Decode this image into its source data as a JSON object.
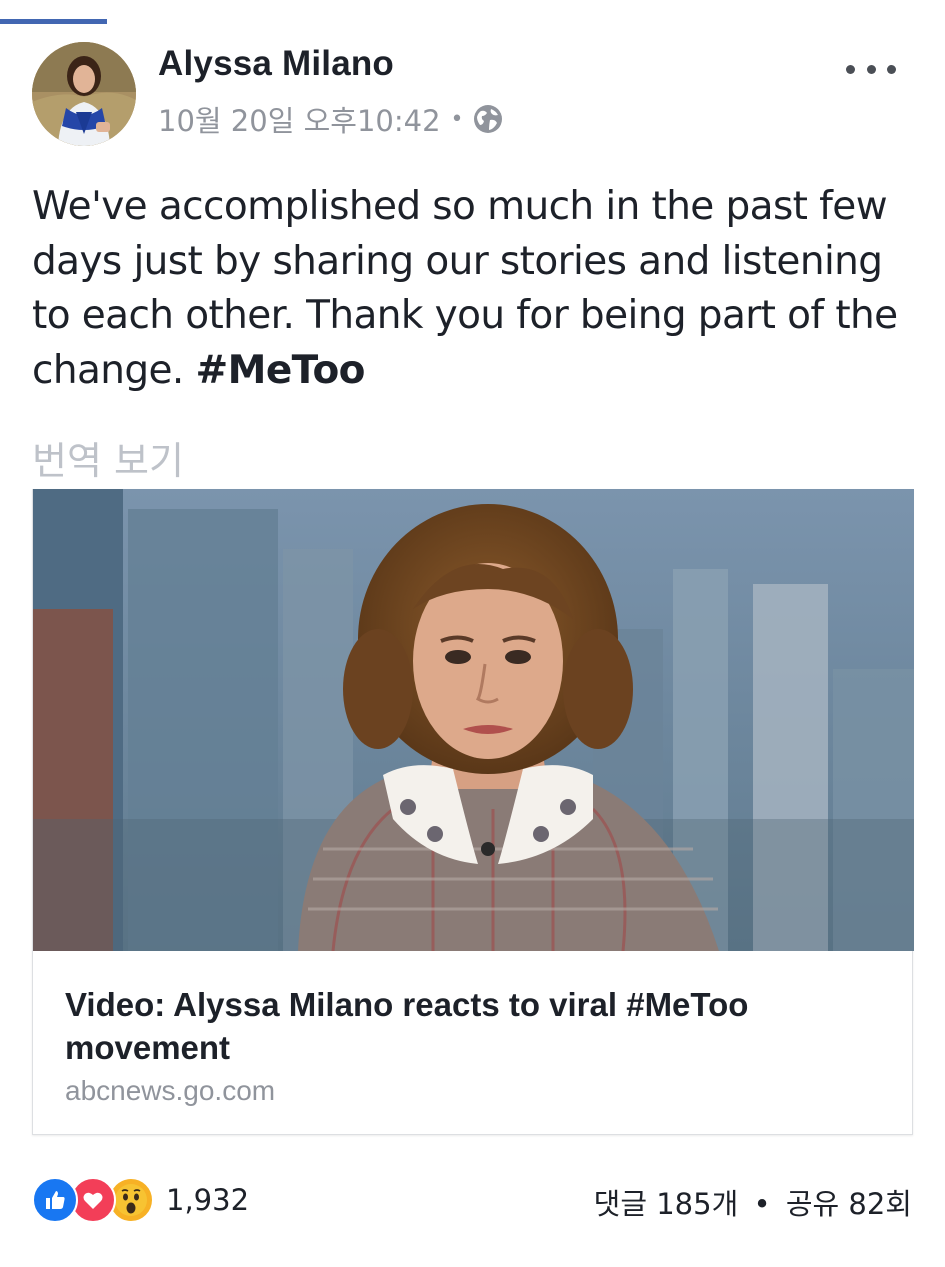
{
  "post": {
    "author": "Alyssa Milano",
    "timestamp": "10월 20일 오후10:42",
    "separator": "•",
    "privacy_icon": "globe-icon",
    "more_icon": "more-dots-icon",
    "text_before_hashtag": "We've accomplished so much in the past few days just by sharing our stories and listening to each other. Thank you for being part of the change. ",
    "hashtag": "#MeToo",
    "translate_label": "번역 보기"
  },
  "link_card": {
    "title": "Video: Alyssa Milano reacts to viral #MeToo movement",
    "domain": "abcnews.go.com"
  },
  "footer": {
    "reaction_icons": [
      "like-icon",
      "love-icon",
      "wow-icon"
    ],
    "reaction_count": "1,932",
    "comments": "댓글 185개",
    "separator": "•",
    "shares": "공유 82회"
  },
  "colors": {
    "accent": "#4267b2",
    "text": "#1d2129",
    "muted": "#90949c",
    "translate": "#bec2c9",
    "like": "#1877f2",
    "love": "#f33e58",
    "wow": "#f7b125"
  }
}
